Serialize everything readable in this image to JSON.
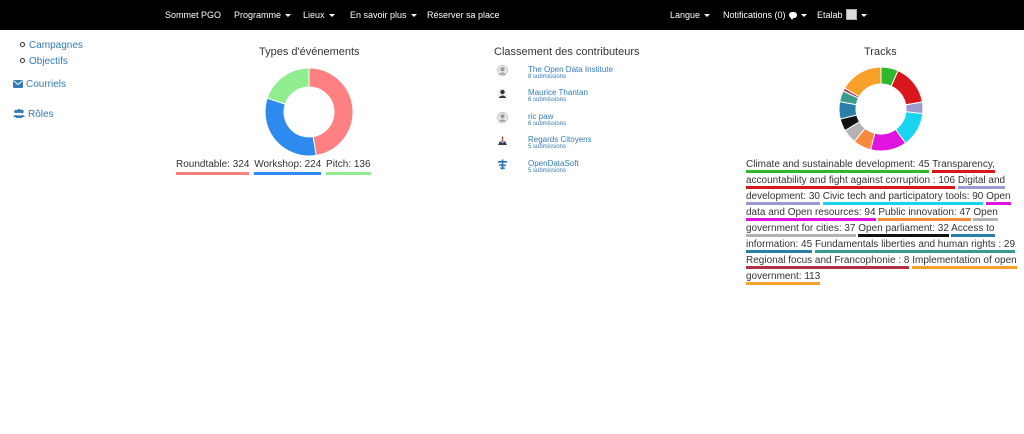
{
  "nav": {
    "brand": "Sommet PGO",
    "programme": "Programme",
    "lieux": "Lieux",
    "en_savoir_plus": "En savoir plus",
    "reserver": "Réserver sa place",
    "langue": "Langue",
    "notifications": "Notifications (0)",
    "user": "Etalab"
  },
  "sidebar": {
    "campagnes": "Campagnes",
    "objectifs": "Objectifs",
    "courriels": "Courriels",
    "roles": "Rôles"
  },
  "event_types": {
    "title": "Types d'événements",
    "legend": [
      {
        "label": "Roundtable: 324",
        "color": "#ff8080"
      },
      {
        "label": "Workshop: 224",
        "color": "#2d8bf0"
      },
      {
        "label": "Pitch: 136",
        "color": "#90ee90"
      }
    ]
  },
  "contributors": {
    "title": "Classement des contributeurs",
    "items": [
      {
        "name": "The Open Data Institute",
        "subs": "8 submissions"
      },
      {
        "name": "Maurice Thantan",
        "subs": "6 submissions"
      },
      {
        "name": "ric paw",
        "subs": "6 submissions"
      },
      {
        "name": "Regards Citoyens",
        "subs": "5 submissions"
      },
      {
        "name": "OpenDataSoft",
        "subs": "5 submissions"
      }
    ]
  },
  "tracks": {
    "title": "Tracks",
    "legend": [
      {
        "label": "Climate and sustainable development: 45",
        "color": "#2eb82e"
      },
      {
        "label": "Transparency, accountability and fight against corruption : 106",
        "color": "#d9161c"
      },
      {
        "label": "Digital and development: 30",
        "color": "#9b9bd0"
      },
      {
        "label": "Civic tech and participatory tools: 90",
        "color": "#18d4f0"
      },
      {
        "label": "Open data and Open resources: 94",
        "color": "#e014e0"
      },
      {
        "label": "Public innovation: 47",
        "color": "#f58a3c"
      },
      {
        "label": "Open government for cities: 37",
        "color": "#b3b3b3"
      },
      {
        "label": "Open parliament: 32",
        "color": "#111111"
      },
      {
        "label": "Access to information: 45",
        "color": "#2a7fa8"
      },
      {
        "label": "Fundamentals liberties and human rights : 29",
        "color": "#3a9a8e"
      },
      {
        "label": "Regional focus and Francophonie : 8",
        "color": "#b03045"
      },
      {
        "label": "Implementation of open government: 113",
        "color": "#f7a02a"
      }
    ]
  },
  "chart_data": [
    {
      "type": "pie",
      "title": "Types d'événements",
      "categories": [
        "Roundtable",
        "Workshop",
        "Pitch"
      ],
      "values": [
        324,
        224,
        136
      ],
      "colors": [
        "#ff8080",
        "#2d8bf0",
        "#90ee90"
      ]
    },
    {
      "type": "pie",
      "title": "Tracks",
      "categories": [
        "Climate and sustainable development",
        "Transparency, accountability and fight against corruption",
        "Digital and development",
        "Civic tech and participatory tools",
        "Open data and Open resources",
        "Public innovation",
        "Open government for cities",
        "Open parliament",
        "Access to information",
        "Fundamentals liberties and human rights",
        "Regional focus and Francophonie",
        "Implementation of open government"
      ],
      "values": [
        45,
        106,
        30,
        90,
        94,
        47,
        37,
        32,
        45,
        29,
        8,
        113
      ],
      "colors": [
        "#2eb82e",
        "#d9161c",
        "#9b9bd0",
        "#18d4f0",
        "#e014e0",
        "#f58a3c",
        "#b3b3b3",
        "#111111",
        "#2a7fa8",
        "#3a9a8e",
        "#b03045",
        "#f7a02a"
      ]
    }
  ]
}
